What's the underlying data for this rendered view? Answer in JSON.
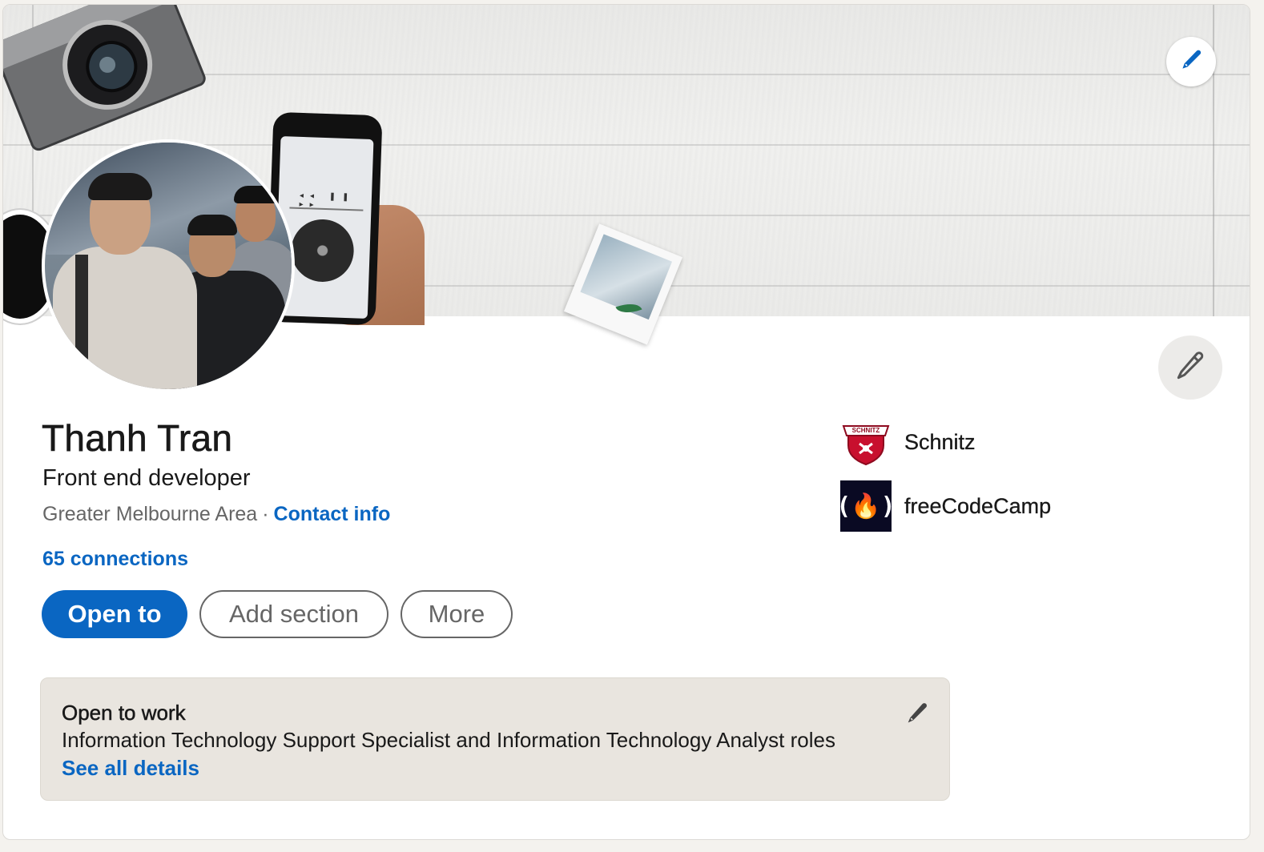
{
  "profile": {
    "name": "Thanh Tran",
    "headline": "Front end developer",
    "location": "Greater Melbourne Area",
    "separator": "·",
    "contact_info": "Contact info",
    "connections": "65 connections"
  },
  "actions": {
    "open_to": "Open to",
    "add_section": "Add section",
    "more": "More"
  },
  "organizations": [
    {
      "name": "Schnitz",
      "logo": "schnitz-logo",
      "logo_text": "SCHNITZ"
    },
    {
      "name": "freeCodeCamp",
      "logo": "freecodecamp-logo",
      "logo_text": "(🔥)"
    }
  ],
  "open_to_work": {
    "title": "Open to work",
    "description": "Information Technology Support Specialist and Information Technology Analyst roles",
    "link": "See all details"
  },
  "icons": {
    "cover_edit": "pencil-icon",
    "intro_edit": "pencil-icon",
    "otw_edit": "pencil-icon"
  },
  "colors": {
    "accent": "#0a66c2",
    "text": "#191919",
    "muted": "#666666",
    "card_bg": "#ffffff",
    "page_bg": "#f4f2ee",
    "otw_bg": "#e9e5df"
  }
}
